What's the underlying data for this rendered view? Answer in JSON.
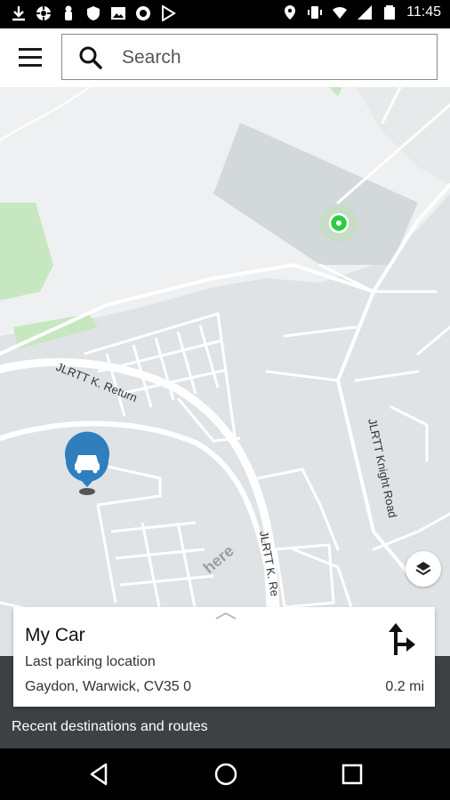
{
  "status_bar": {
    "time": "11:45",
    "left_icons": [
      "download-icon",
      "settings-cog-icon",
      "hand-icon",
      "shield-icon",
      "image-icon",
      "circle-icon",
      "play-store-icon"
    ],
    "right_icons": [
      "location-pin-icon",
      "vibrate-icon",
      "wifi-icon",
      "signal-icon",
      "battery-icon"
    ]
  },
  "header": {
    "search_placeholder": "Search"
  },
  "map": {
    "road_labels": [
      "JLRTT K. Return",
      "JLRTT Knight Road",
      "JLRTT K. Re"
    ],
    "watermark": "here",
    "colors": {
      "land": "#dfe3e5",
      "light_area": "#eef0f1",
      "green": "#c6e7c0",
      "road": "#ffffff",
      "pin": "#2f7fbf",
      "current_location": "#2ecc40"
    }
  },
  "card": {
    "title": "My Car",
    "subtitle": "Last parking location",
    "address": "Gaydon, Warwick, CV35 0",
    "distance": "0.2 mi"
  },
  "recent_label": "Recent destinations and routes"
}
